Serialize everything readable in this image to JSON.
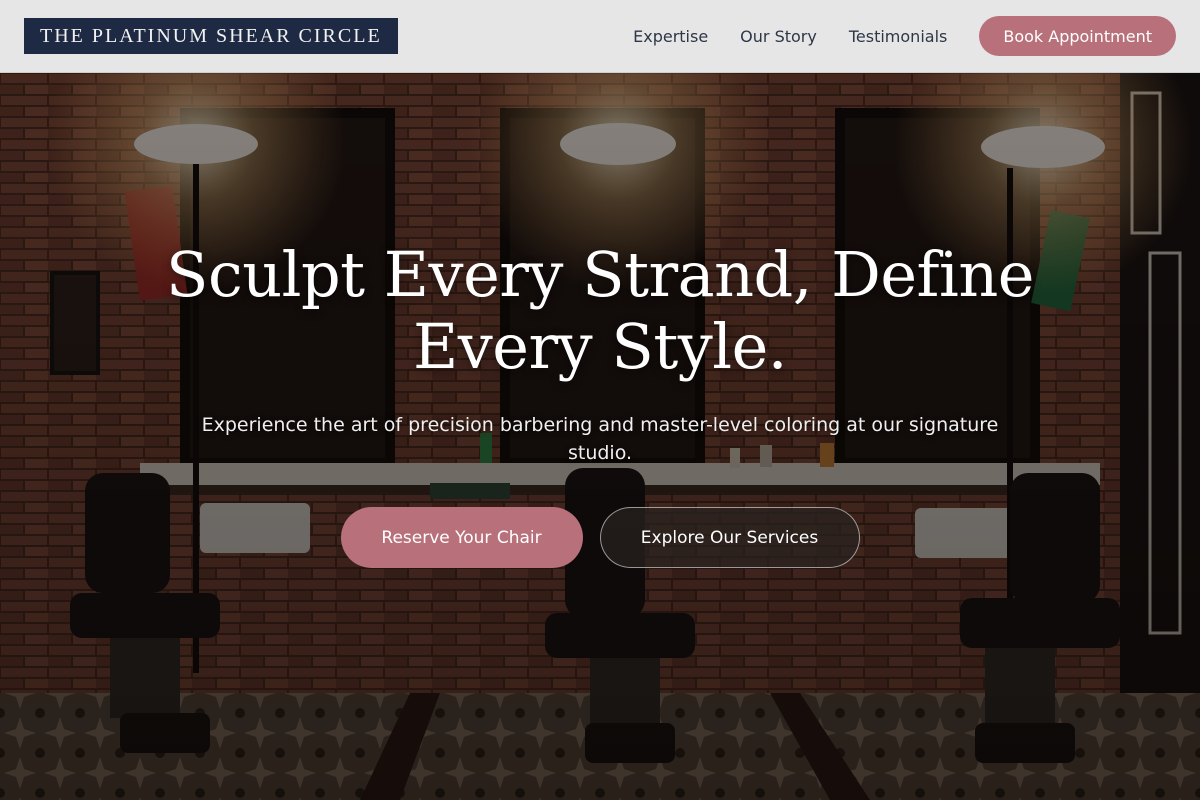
{
  "header": {
    "logo": "THE PLATINUM SHEAR CIRCLE",
    "nav": [
      {
        "label": "Expertise"
      },
      {
        "label": "Our Story"
      },
      {
        "label": "Testimonials"
      }
    ],
    "cta_label": "Book Appointment"
  },
  "hero": {
    "title": "Sculpt Every Strand, Define Every Style.",
    "subtitle": "Experience the art of precision barbering and master-level coloring at our signature studio.",
    "primary_label": "Reserve Your Chair",
    "secondary_label": "Explore Our Services"
  },
  "colors": {
    "accent": "#b8707b",
    "logo_background": "#1e2a44",
    "header_background": "#e6e6e6"
  }
}
